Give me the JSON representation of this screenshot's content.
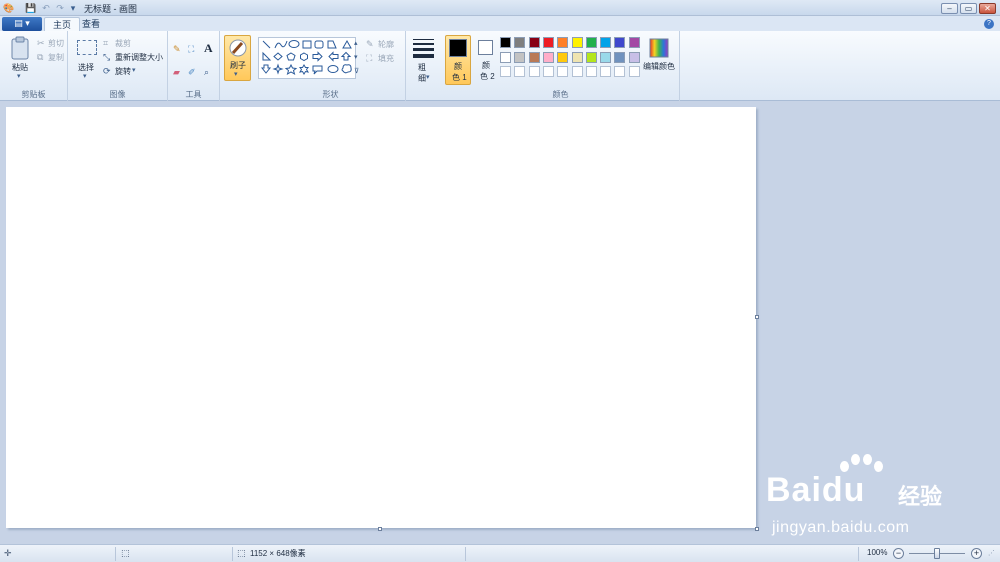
{
  "window": {
    "title": "无标题 - 画图"
  },
  "tabs": [
    {
      "label": "主页"
    },
    {
      "label": "查看"
    }
  ],
  "clipboard": {
    "paste": "粘贴",
    "cut": "剪切",
    "copy": "复制",
    "group": "剪贴板"
  },
  "image": {
    "select": "选择",
    "crop": "裁剪",
    "resize": "重新调整大小",
    "rotate": "旋转",
    "group": "图像"
  },
  "tools": {
    "text_glyph": "A",
    "group": "工具"
  },
  "brushes": {
    "label": "刷子"
  },
  "shapes": {
    "outline": "轮廓",
    "fill": "填充",
    "group": "形状"
  },
  "size": {
    "label_top": "粗",
    "label_bottom": "细"
  },
  "colors": {
    "color1_top": "颜",
    "color1_bottom": "色 1",
    "color2_top": "颜",
    "color2_bottom": "色 2",
    "edit": "编辑颜色",
    "group": "颜色",
    "color1_value": "#000000",
    "color2_value": "#ffffff",
    "palette_row1": [
      "#000000",
      "#7f7f7f",
      "#880015",
      "#ed1c24",
      "#ff7f27",
      "#fff200",
      "#22b14c",
      "#00a2e8",
      "#3f48cc",
      "#a349a4"
    ],
    "palette_row2": [
      "#ffffff",
      "#c3c3c3",
      "#b97a57",
      "#ffaec9",
      "#ffc90e",
      "#efe4b0",
      "#b5e61d",
      "#99d9ea",
      "#7092be",
      "#c8bfe7"
    ],
    "palette_row3": [
      "#ffffff",
      "#ffffff",
      "#ffffff",
      "#ffffff",
      "#ffffff",
      "#ffffff",
      "#ffffff",
      "#ffffff",
      "#ffffff",
      "#ffffff"
    ]
  },
  "status": {
    "dimensions": "1152 × 648像素",
    "zoom": "100%",
    "zoom_level": 1.0
  },
  "watermark": {
    "brand": "Baidu",
    "suffix": "经验",
    "url": "jingyan.baidu.com"
  }
}
